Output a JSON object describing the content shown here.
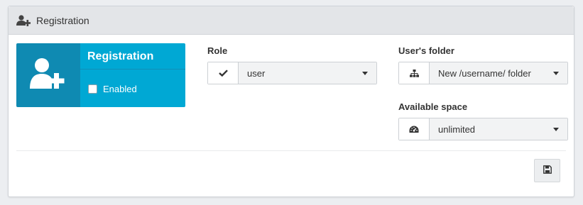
{
  "panel": {
    "title": "Registration",
    "icon": "user-plus-icon"
  },
  "tile": {
    "title": "Registration",
    "icon": "user-plus-icon",
    "enabled_label": "Enabled",
    "enabled_checked": false,
    "colors": {
      "dark": "#0f8ab2",
      "light": "#00a8d4"
    }
  },
  "role": {
    "label": "Role",
    "icon": "check-icon",
    "value": "user"
  },
  "folder": {
    "label": "User's folder",
    "icon": "sitemap-icon",
    "value": "New /username/ folder"
  },
  "space": {
    "label": "Available space",
    "icon": "dashboard-icon",
    "value": "unlimited"
  },
  "save": {
    "icon": "save-icon"
  }
}
